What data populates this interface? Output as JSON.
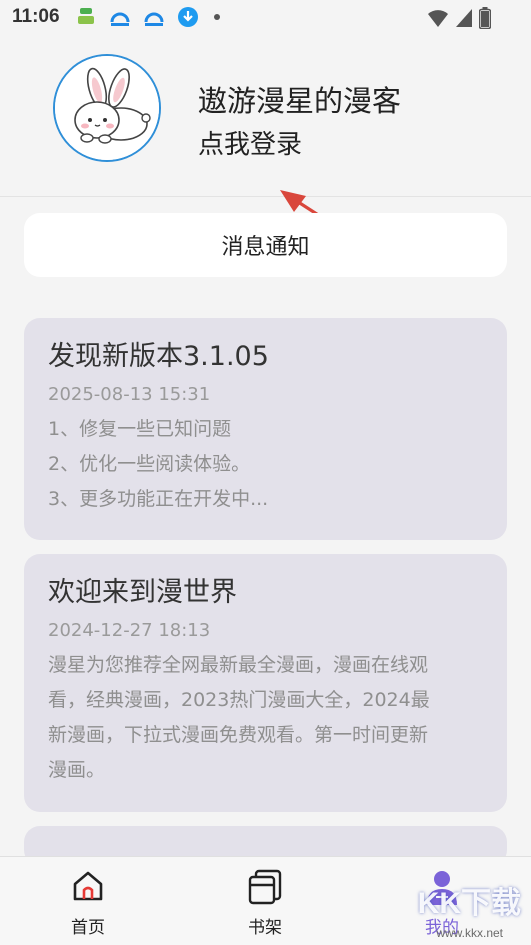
{
  "status_bar": {
    "time": "11:06"
  },
  "profile": {
    "username": "遨游漫星的漫客",
    "login_label": "点我登录"
  },
  "notice": {
    "label": "消息通知"
  },
  "cards": [
    {
      "title": "发现新版本3.1.05",
      "date": "2025-08-13 15:31",
      "lines": [
        "1、修复一些已知问题",
        "2、优化一些阅读体验。",
        "3、更多功能正在开发中..."
      ]
    },
    {
      "title": "欢迎来到漫世界",
      "date": "2024-12-27 18:13",
      "lines": [
        "漫星为您推荐全网最新最全漫画，漫画在线观",
        "看，经典漫画，2023热门漫画大全，2024最",
        "新漫画，下拉式漫画免费观看。第一时间更新",
        "漫画。"
      ]
    }
  ],
  "nav": {
    "home": "首页",
    "bookshelf": "书架",
    "mine": "我的"
  },
  "watermark": {
    "brand": "KK下载",
    "url": "www.kkx.net"
  },
  "colors": {
    "accent": "#7b63d8",
    "card_bg": "#e3e1ea",
    "avatar_ring": "#2f8fd8",
    "arrow": "#d9473c"
  }
}
